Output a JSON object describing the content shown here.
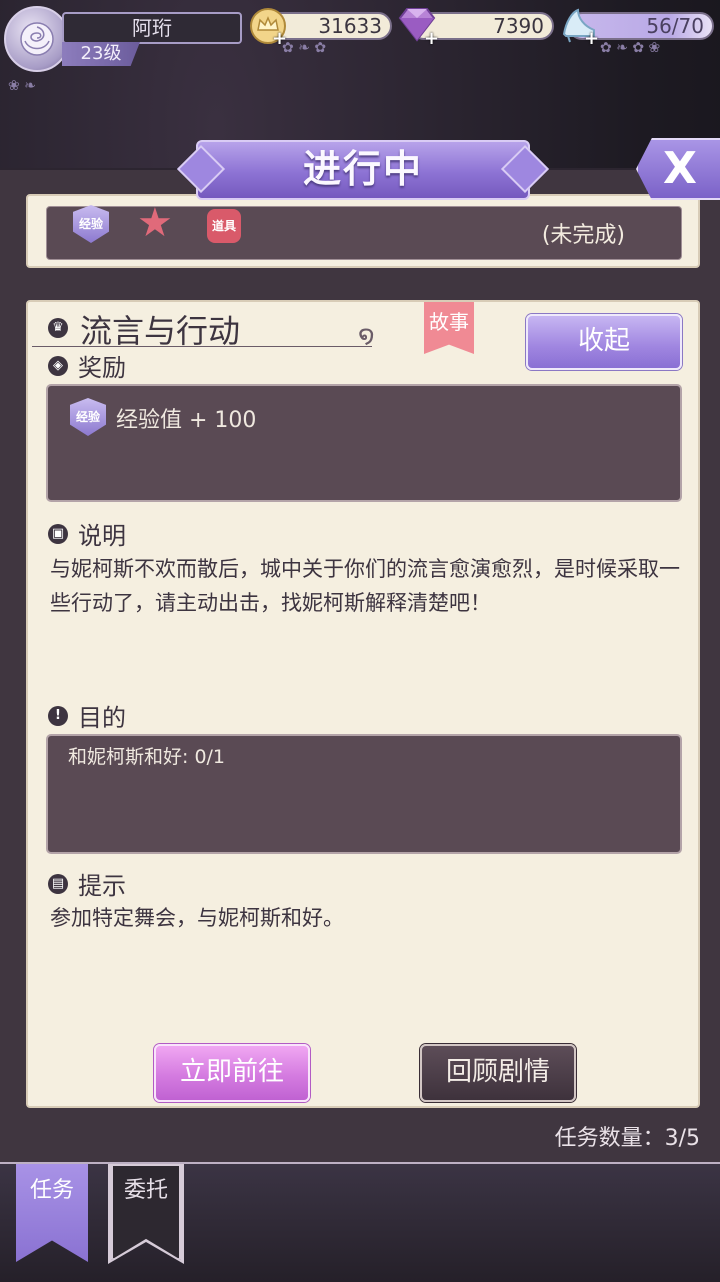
{
  "player": {
    "name": "阿珩",
    "level": "23级"
  },
  "resources": {
    "gold": "31633",
    "gems": "7390",
    "energy": "56/70",
    "plus": "+"
  },
  "header": {
    "title": "进行中",
    "close_label": "X"
  },
  "previous_quest": {
    "exp_badge": "经验",
    "item_badge": "道具",
    "status": "(未完成)"
  },
  "quest": {
    "title": "流言与行动",
    "tag": "故事",
    "collapse_label": "收起",
    "reward_heading": "奖励",
    "reward_badge": "经验",
    "reward_text": "经验值 + 100",
    "desc_heading": "说明",
    "description": "与妮柯斯不欢而散后，城中关于你们的流言愈演愈烈，是时候采取一些行动了，请主动出击，找妮柯斯解释清楚吧！",
    "goal_heading": "目的",
    "goal_text": "和妮柯斯和好: 0/1",
    "hint_heading": "提示",
    "hint_text": "参加特定舞会，与妮柯斯和好。",
    "go_label": "立即前往",
    "review_label": "回顾剧情"
  },
  "quest_count": "任务数量：3/5",
  "tabs": [
    {
      "label": "任务",
      "active": true
    },
    {
      "label": "委托",
      "active": false
    }
  ],
  "colors": {
    "accent_purple": "#8d73d4",
    "card_bg": "#f5efe0",
    "dark_box": "#5a4a54",
    "story_tag": "#f08a94",
    "go_button": "#d47be0"
  },
  "icons": {
    "avatar": "rose-icon",
    "gold": "crown-coin-icon",
    "gems": "diamond-icon",
    "energy": "glass-slipper-icon"
  }
}
